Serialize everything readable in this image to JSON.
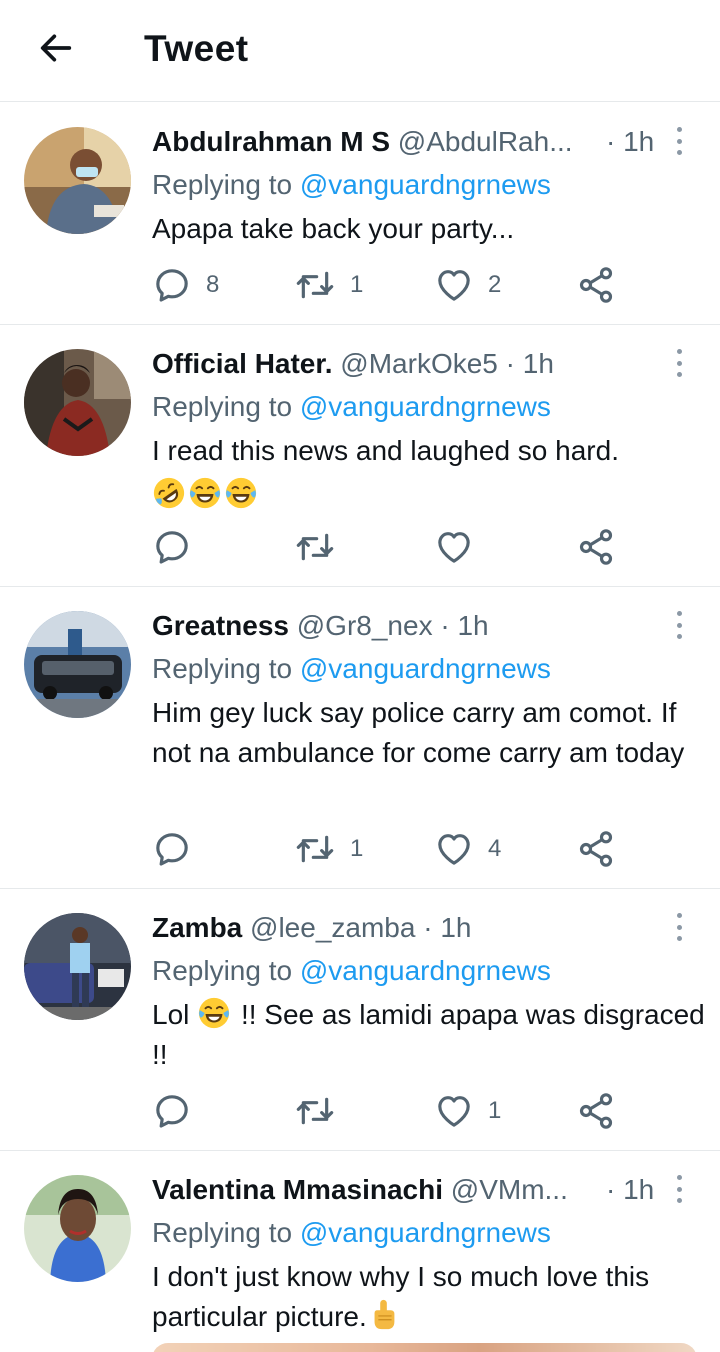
{
  "header": {
    "title": "Tweet"
  },
  "tweets": [
    {
      "name": "Abdulrahman M S",
      "handle": "@AbdulRah...",
      "time": "· 1h",
      "replying_label": "Replying to",
      "replying_to": "@vanguardngrnews",
      "text": "Apapa take back your party...",
      "replies": "8",
      "retweets": "1",
      "likes": "2"
    },
    {
      "name": "Official Hater.",
      "handle": "@MarkOke5",
      "time": "· 1h",
      "replying_label": "Replying to",
      "replying_to": "@vanguardngrnews",
      "text": "I read this news and laughed so hard.",
      "emojis": [
        "rolling-on-floor-laughing",
        "tears-of-joy",
        "tears-of-joy"
      ],
      "replies": "",
      "retweets": "",
      "likes": ""
    },
    {
      "name": "Greatness",
      "handle": "@Gr8_nex",
      "time": "· 1h",
      "replying_label": "Replying to",
      "replying_to": "@vanguardngrnews",
      "text": "Him gey luck say police carry am comot. If not na ambulance for come carry am today",
      "replies": "",
      "retweets": "1",
      "likes": "4"
    },
    {
      "name": "Zamba",
      "handle": "@lee_zamba",
      "time": "· 1h",
      "replying_label": "Replying to",
      "replying_to": "@vanguardngrnews",
      "text_before": "Lol",
      "text_after": "!! See as lamidi apapa was disgraced !!",
      "emojis": [
        "tears-of-joy"
      ],
      "replies": "",
      "retweets": "",
      "likes": "1"
    },
    {
      "name": "Valentina Mmasinachi",
      "handle": "@VMm...",
      "time": "· 1h",
      "replying_label": "Replying to",
      "replying_to": "@vanguardngrnews",
      "text": "I don't just know why I so much love this particular picture.",
      "emojis": [
        "backhand-index-pointing-down"
      ]
    }
  ],
  "icons": {
    "back": "arrow-left-icon",
    "more": "more-vertical-icon",
    "reply": "reply-icon",
    "retweet": "retweet-icon",
    "like": "heart-icon",
    "share": "share-icon"
  },
  "colors": {
    "accent": "#1d9bf0",
    "secondary_text": "#536471",
    "icon": "#536471"
  }
}
